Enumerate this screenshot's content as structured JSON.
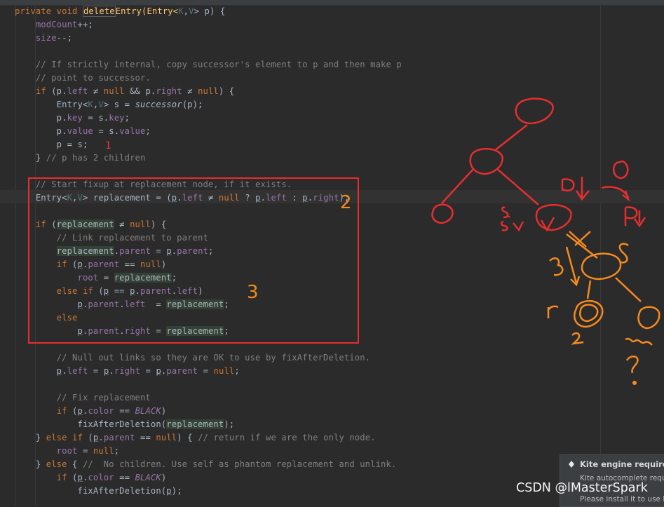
{
  "code_lines": [
    [
      {
        "t": "private void ",
        "c": "kw"
      },
      {
        "t": "delete",
        "c": "fn hlbox"
      },
      {
        "t": "Entry(Entry<",
        "c": "fn"
      },
      {
        "t": "K",
        "c": "ty"
      },
      {
        "t": ",",
        "c": ""
      },
      {
        "t": "V",
        "c": "ty"
      },
      {
        "t": "> p) {",
        "c": ""
      }
    ],
    [
      {
        "t": "    modCount",
        "c": "fld"
      },
      {
        "t": "++;",
        "c": ""
      }
    ],
    [
      {
        "t": "    size",
        "c": "fld"
      },
      {
        "t": "--;",
        "c": ""
      }
    ],
    [],
    [
      {
        "t": "    // If strictly internal, copy successor's element to p and then make p",
        "c": "cm"
      }
    ],
    [
      {
        "t": "    // point to successor.",
        "c": "cm"
      }
    ],
    [
      {
        "t": "    if ",
        "c": "kw"
      },
      {
        "t": "(p.",
        "c": ""
      },
      {
        "t": "left",
        "c": "fld"
      },
      {
        "t": " ≠ ",
        "c": ""
      },
      {
        "t": "null",
        "c": "kw"
      },
      {
        "t": " && p.",
        "c": ""
      },
      {
        "t": "right",
        "c": "fld"
      },
      {
        "t": " ≠ ",
        "c": ""
      },
      {
        "t": "null",
        "c": "kw"
      },
      {
        "t": ") {",
        "c": ""
      }
    ],
    [
      {
        "t": "        Entry<",
        "c": ""
      },
      {
        "t": "K",
        "c": "ty"
      },
      {
        "t": ",",
        "c": ""
      },
      {
        "t": "V",
        "c": "ty"
      },
      {
        "t": "> s = ",
        "c": ""
      },
      {
        "t": "successor",
        "c": "it"
      },
      {
        "t": "(p);",
        "c": ""
      }
    ],
    [
      {
        "t": "        p.",
        "c": ""
      },
      {
        "t": "key",
        "c": "fld"
      },
      {
        "t": " = s.",
        "c": ""
      },
      {
        "t": "key",
        "c": "fld"
      },
      {
        "t": ";",
        "c": ""
      }
    ],
    [
      {
        "t": "        p.",
        "c": ""
      },
      {
        "t": "value",
        "c": "fld"
      },
      {
        "t": " = s.",
        "c": ""
      },
      {
        "t": "value",
        "c": "fld"
      },
      {
        "t": ";",
        "c": ""
      }
    ],
    [
      {
        "t": "        p = s;",
        "c": ""
      }
    ],
    [
      {
        "t": "    } ",
        "c": ""
      },
      {
        "t": "// p has 2 children",
        "c": "cm"
      }
    ],
    [],
    [
      {
        "t": "    // Start fixup at replacement node, if it exists.",
        "c": "cm"
      }
    ],
    [
      {
        "t": "    Entry<",
        "c": ""
      },
      {
        "t": "K",
        "c": "ty"
      },
      {
        "t": ",",
        "c": ""
      },
      {
        "t": "V",
        "c": "ty"
      },
      {
        "t": "> replacement = (",
        "c": ""
      },
      {
        "t": "p",
        "c": "ul"
      },
      {
        "t": ".",
        "c": ""
      },
      {
        "t": "left",
        "c": "fld"
      },
      {
        "t": " ≠ ",
        "c": ""
      },
      {
        "t": "null",
        "c": "kw"
      },
      {
        "t": " ? ",
        "c": ""
      },
      {
        "t": "p",
        "c": "ul"
      },
      {
        "t": ".",
        "c": ""
      },
      {
        "t": "left",
        "c": "fld"
      },
      {
        "t": " : ",
        "c": ""
      },
      {
        "t": "p",
        "c": "ul"
      },
      {
        "t": ".",
        "c": ""
      },
      {
        "t": "right",
        "c": "fld"
      },
      {
        "t": ");",
        "c": ""
      }
    ],
    [],
    [
      {
        "t": "    if ",
        "c": "kw"
      },
      {
        "t": "(",
        "c": ""
      },
      {
        "t": "replacement",
        "c": "hl"
      },
      {
        "t": " ≠ ",
        "c": ""
      },
      {
        "t": "null",
        "c": "kw"
      },
      {
        "t": ") {",
        "c": ""
      }
    ],
    [
      {
        "t": "        // Link replacement to parent",
        "c": "cm"
      }
    ],
    [
      {
        "t": "        ",
        "c": ""
      },
      {
        "t": "replacement",
        "c": "hl"
      },
      {
        "t": ".",
        "c": ""
      },
      {
        "t": "parent",
        "c": "fld"
      },
      {
        "t": " = ",
        "c": ""
      },
      {
        "t": "p",
        "c": "ul"
      },
      {
        "t": ".",
        "c": ""
      },
      {
        "t": "parent",
        "c": "fld"
      },
      {
        "t": ";",
        "c": ""
      }
    ],
    [
      {
        "t": "        if ",
        "c": "kw"
      },
      {
        "t": "(",
        "c": ""
      },
      {
        "t": "p",
        "c": "ul"
      },
      {
        "t": ".",
        "c": ""
      },
      {
        "t": "parent",
        "c": "fld"
      },
      {
        "t": " == ",
        "c": ""
      },
      {
        "t": "null",
        "c": "kw"
      },
      {
        "t": ")",
        "c": ""
      }
    ],
    [
      {
        "t": "            ",
        "c": ""
      },
      {
        "t": "root",
        "c": "fld"
      },
      {
        "t": " = ",
        "c": ""
      },
      {
        "t": "replacement",
        "c": "hl"
      },
      {
        "t": ";",
        "c": ""
      }
    ],
    [
      {
        "t": "        else if ",
        "c": "kw"
      },
      {
        "t": "(",
        "c": ""
      },
      {
        "t": "p",
        "c": "ul"
      },
      {
        "t": " == ",
        "c": ""
      },
      {
        "t": "p",
        "c": "ul"
      },
      {
        "t": ".",
        "c": ""
      },
      {
        "t": "parent",
        "c": "fld"
      },
      {
        "t": ".",
        "c": ""
      },
      {
        "t": "left",
        "c": "fld"
      },
      {
        "t": ")",
        "c": ""
      }
    ],
    [
      {
        "t": "            ",
        "c": ""
      },
      {
        "t": "p",
        "c": "ul"
      },
      {
        "t": ".",
        "c": ""
      },
      {
        "t": "parent",
        "c": "fld"
      },
      {
        "t": ".",
        "c": ""
      },
      {
        "t": "left",
        "c": "fld"
      },
      {
        "t": "  = ",
        "c": ""
      },
      {
        "t": "replacement",
        "c": "hl"
      },
      {
        "t": ";",
        "c": ""
      }
    ],
    [
      {
        "t": "        else",
        "c": "kw"
      }
    ],
    [
      {
        "t": "            ",
        "c": ""
      },
      {
        "t": "p",
        "c": "ul"
      },
      {
        "t": ".",
        "c": ""
      },
      {
        "t": "parent",
        "c": "fld"
      },
      {
        "t": ".",
        "c": ""
      },
      {
        "t": "right",
        "c": "fld"
      },
      {
        "t": " = ",
        "c": ""
      },
      {
        "t": "replacement",
        "c": "hl"
      },
      {
        "t": ";",
        "c": ""
      }
    ],
    [],
    [
      {
        "t": "        // Null out links so they are OK to use by fixAfterDeletion.",
        "c": "cm"
      }
    ],
    [
      {
        "t": "        ",
        "c": ""
      },
      {
        "t": "p",
        "c": "ul"
      },
      {
        "t": ".",
        "c": ""
      },
      {
        "t": "left",
        "c": "fld"
      },
      {
        "t": " = ",
        "c": ""
      },
      {
        "t": "p",
        "c": "ul"
      },
      {
        "t": ".",
        "c": ""
      },
      {
        "t": "right",
        "c": "fld"
      },
      {
        "t": " = ",
        "c": ""
      },
      {
        "t": "p",
        "c": "ul"
      },
      {
        "t": ".",
        "c": ""
      },
      {
        "t": "parent",
        "c": "fld"
      },
      {
        "t": " = ",
        "c": ""
      },
      {
        "t": "null",
        "c": "kw"
      },
      {
        "t": ";",
        "c": ""
      }
    ],
    [],
    [
      {
        "t": "        // Fix replacement",
        "c": "cm"
      }
    ],
    [
      {
        "t": "        if ",
        "c": "kw"
      },
      {
        "t": "(",
        "c": ""
      },
      {
        "t": "p",
        "c": "ul"
      },
      {
        "t": ".",
        "c": ""
      },
      {
        "t": "color",
        "c": "fld"
      },
      {
        "t": " == ",
        "c": ""
      },
      {
        "t": "BLACK",
        "c": "fld it"
      },
      {
        "t": ")",
        "c": ""
      }
    ],
    [
      {
        "t": "            fixAfterDeletion(",
        "c": ""
      },
      {
        "t": "replacement",
        "c": "hl"
      },
      {
        "t": ");",
        "c": ""
      }
    ],
    [
      {
        "t": "    } ",
        "c": ""
      },
      {
        "t": "else if ",
        "c": "kw"
      },
      {
        "t": "(",
        "c": ""
      },
      {
        "t": "p",
        "c": "ul"
      },
      {
        "t": ".",
        "c": ""
      },
      {
        "t": "parent",
        "c": "fld"
      },
      {
        "t": " == ",
        "c": ""
      },
      {
        "t": "null",
        "c": "kw"
      },
      {
        "t": ") { ",
        "c": ""
      },
      {
        "t": "// return if we are the only node.",
        "c": "cm"
      }
    ],
    [
      {
        "t": "        ",
        "c": ""
      },
      {
        "t": "root",
        "c": "fld"
      },
      {
        "t": " = ",
        "c": ""
      },
      {
        "t": "null",
        "c": "kw"
      },
      {
        "t": ";",
        "c": ""
      }
    ],
    [
      {
        "t": "    } ",
        "c": ""
      },
      {
        "t": "else ",
        "c": "kw"
      },
      {
        "t": "{ ",
        "c": ""
      },
      {
        "t": "//  No children. Use self as phantom replacement and unlink.",
        "c": "cm"
      }
    ],
    [
      {
        "t": "        if ",
        "c": "kw"
      },
      {
        "t": "(",
        "c": ""
      },
      {
        "t": "p",
        "c": "ul"
      },
      {
        "t": ".",
        "c": ""
      },
      {
        "t": "color",
        "c": "fld"
      },
      {
        "t": " == ",
        "c": ""
      },
      {
        "t": "BLACK",
        "c": "fld it"
      },
      {
        "t": ")",
        "c": ""
      }
    ],
    [
      {
        "t": "            fixAfterDeletion(",
        "c": ""
      },
      {
        "t": "p",
        "c": "ul"
      },
      {
        "t": ");",
        "c": ""
      }
    ]
  ],
  "annotations": {
    "mark_one": "1",
    "mark_two": "2",
    "mark_three": "3",
    "tree_label_sk": "s.K",
    "tree_label_sv": "s.V",
    "tree_label_p_left": "p",
    "tree_label_p_right": "p",
    "tree_label_zero": "0",
    "tree_label_three": "3",
    "tree_label_s": "s",
    "tree_label_r": "r",
    "tree_label_two": "2.",
    "tree_label_q": "?"
  },
  "notification": {
    "title": "Kite engine required",
    "line1": "Kite autocomplete requ",
    "line2": "Please install it to use k"
  },
  "watermark": "CSDN @lMasterSpark"
}
